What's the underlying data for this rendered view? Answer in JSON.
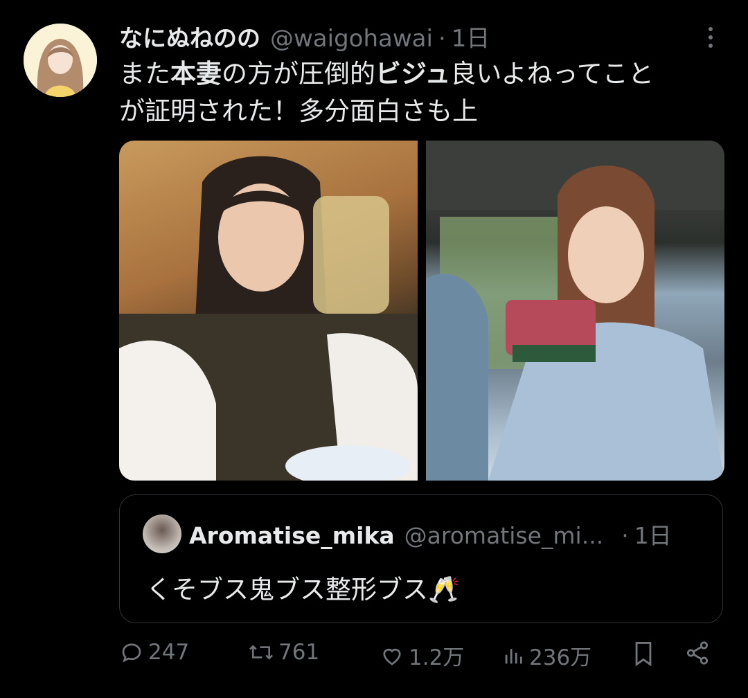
{
  "tweet": {
    "display_name": "なにぬねのの",
    "handle": "@waigohawai",
    "separator": "·",
    "time": "1日",
    "text_parts": [
      "また",
      "本妻",
      "の方が圧倒的",
      "ビジュ",
      "良いよねってこと",
      "が証明された！多分面白さも上"
    ]
  },
  "quote": {
    "display_name": "Aromatise_mika",
    "handle": "@aromatise_mi...",
    "separator": "·",
    "time": "1日",
    "text": "くそブス鬼ブス整形ブス",
    "emoji": "🥂"
  },
  "actions": {
    "replies": "247",
    "retweets": "761",
    "likes": "1.2万",
    "views": "236万"
  },
  "icons": [
    "more-icon",
    "reply-icon",
    "retweet-icon",
    "like-icon",
    "views-icon",
    "bookmark-icon",
    "share-icon"
  ]
}
